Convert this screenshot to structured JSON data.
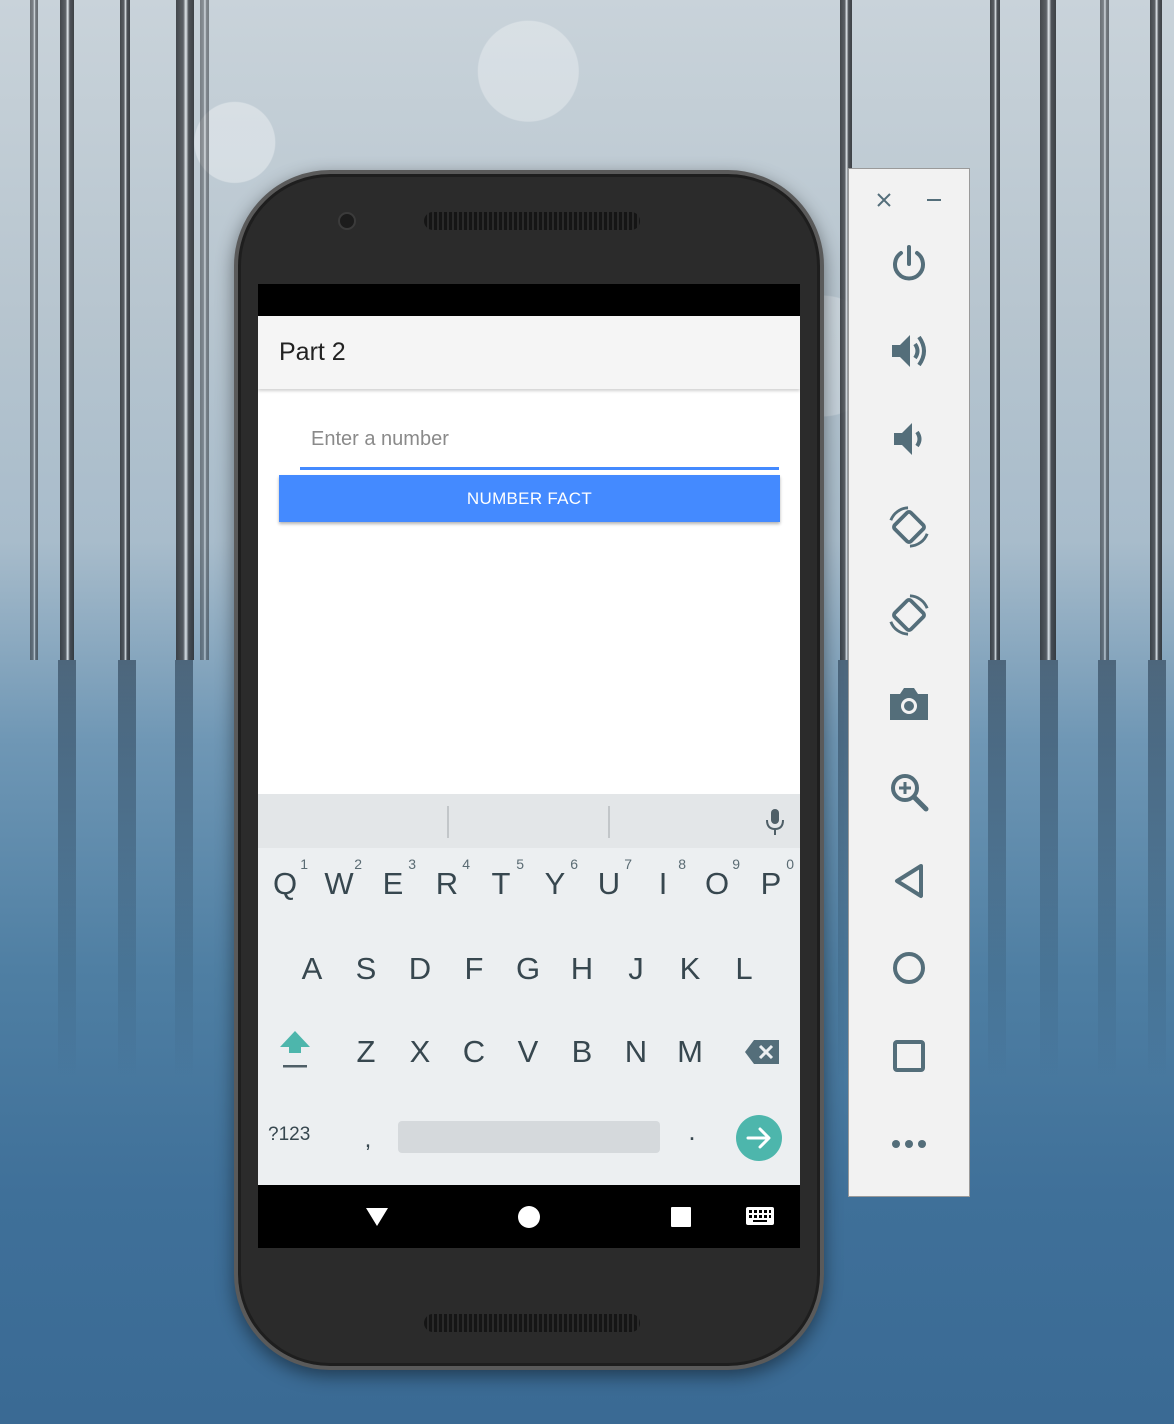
{
  "app": {
    "title": "Part 2"
  },
  "form": {
    "input_placeholder": "Enter a number",
    "input_value": "",
    "button_label": "NUMBER FACT"
  },
  "keyboard": {
    "row1": [
      {
        "key": "Q",
        "hint": "1"
      },
      {
        "key": "W",
        "hint": "2"
      },
      {
        "key": "E",
        "hint": "3"
      },
      {
        "key": "R",
        "hint": "4"
      },
      {
        "key": "T",
        "hint": "5"
      },
      {
        "key": "Y",
        "hint": "6"
      },
      {
        "key": "U",
        "hint": "7"
      },
      {
        "key": "I",
        "hint": "8"
      },
      {
        "key": "O",
        "hint": "9"
      },
      {
        "key": "P",
        "hint": "0"
      }
    ],
    "row2": [
      "A",
      "S",
      "D",
      "F",
      "G",
      "H",
      "J",
      "K",
      "L"
    ],
    "row3": [
      "Z",
      "X",
      "C",
      "V",
      "B",
      "N",
      "M"
    ],
    "symbols_label": "?123",
    "comma_label": ",",
    "period_label": ".",
    "icons": [
      "shift-icon",
      "backspace-icon",
      "enter-arrow-icon",
      "mic-icon"
    ],
    "accent_color": "#4db6ac"
  },
  "navbar": {
    "icons": [
      "back-icon",
      "home-icon",
      "recents-icon",
      "keyboard-switch-icon"
    ]
  },
  "emulator_toolbar": {
    "icons": [
      "close-icon",
      "minimize-icon",
      "power-icon",
      "volume-up-icon",
      "volume-down-icon",
      "rotate-left-icon",
      "rotate-right-icon",
      "camera-icon",
      "zoom-icon",
      "back-icon",
      "home-icon",
      "overview-icon",
      "more-icon"
    ]
  },
  "colors": {
    "accent": "#448aff",
    "toolbar_icon": "#546e7a"
  }
}
